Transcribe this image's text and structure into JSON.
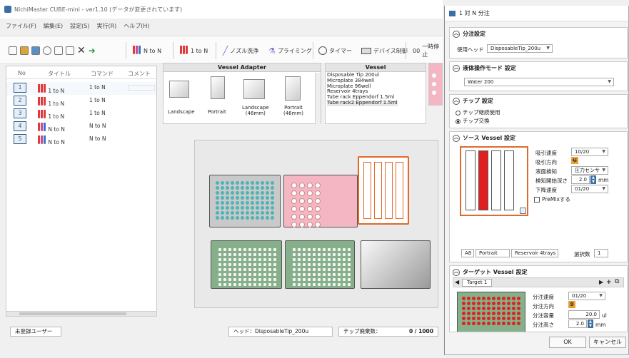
{
  "app": {
    "title": "NichiMaster CUBE-mini - ver1.10 (データが変更されています)"
  },
  "menu": [
    "ファイル(F)",
    "編集(E)",
    "設定(S)",
    "実行(R)",
    "ヘルプ(H)"
  ],
  "toolbar": {
    "n_to_n": "N to N",
    "one_to_n": "1 to N",
    "nozzle_wash": "ノズル洗浄",
    "priming": "プライミング",
    "timer": "タイマー",
    "device_ctrl": "デバイス制御",
    "pause": "一時停止",
    "hash": "00"
  },
  "protocol": {
    "headers": {
      "no": "No",
      "title": "タイトル",
      "command": "コマンド",
      "comment": "コメント"
    },
    "rows": [
      {
        "no": "1",
        "title": "1 to N",
        "command": "1 to N",
        "selected": true
      },
      {
        "no": "2",
        "title": "1 to N",
        "command": "1 to N"
      },
      {
        "no": "3",
        "title": "1 to N",
        "command": "1 to N"
      },
      {
        "no": "4",
        "title": "N to N",
        "command": "N to N"
      },
      {
        "no": "5",
        "title": "N to N",
        "command": "N to N"
      }
    ]
  },
  "vessel_adapter": {
    "title": "Vessel Adapter",
    "items": [
      "Landscape",
      "Portrait",
      "Landscape\n(46mm)",
      "Portrait\n(46mm)"
    ]
  },
  "vessel": {
    "title": "Vessel",
    "items": [
      "Disposable Tip 200ul",
      "Microplate 384well",
      "Microplate 96well",
      "Reservoir 4trays",
      "Tube rack Eppendorf 1.5ml",
      "Tube rack2 Eppendorf 1.5ml"
    ]
  },
  "status": {
    "user": "未登録ユーザー",
    "head": "ヘッド：DisposableTip_200u",
    "tip_label": "チップ廃棄数：",
    "tip_count": "0 / 1000"
  },
  "dialog": {
    "title": "1 対 N 分注",
    "dispense_settings": {
      "title": "分注設定",
      "head_label": "使用ヘッド",
      "head_value": "DisposableTip_200u"
    },
    "liquid_mode": {
      "title": "液体操作モード 設定",
      "value": "Water 200"
    },
    "tip_settings": {
      "title": "チップ 設定",
      "opt1": "チップ継続使用",
      "opt2": "チップ交換"
    },
    "source": {
      "title": "ソース Vessel 設定",
      "asp_speed_label": "吸引速度",
      "asp_speed": "10/20",
      "asp_dir_label": "吸引方向",
      "liquid_detect_label": "液面検知",
      "liquid_detect": "圧力センサ",
      "depth_label": "検知開始深さ",
      "depth": "2.0",
      "depth_unit": "mm",
      "descend_label": "下降速度",
      "descend": "01/20",
      "premix": "PreMixする",
      "pos": "A8",
      "orientation": "Portrait",
      "vessel": "Reservoir 4trays",
      "select_label": "選択数",
      "select_count": "1"
    },
    "target": {
      "title": "ターゲット Vessel 設定",
      "tab": "Target 1",
      "speed_label": "分注速度",
      "speed": "01/20",
      "dir_label": "分注方向",
      "vol_label": "分注容量",
      "vol": "20.0",
      "vol_unit": "ul",
      "height_label": "分注高さ",
      "height": "2.0",
      "height_unit": "mm"
    },
    "ok": "OK",
    "cancel": "キャンセル"
  },
  "colors": {
    "accent": "#2c5f8a",
    "red": "#e02020",
    "pink": "#f4b6c2",
    "green": "#86b08a",
    "teal": "#4db4b8",
    "orange": "#e06a2a"
  }
}
